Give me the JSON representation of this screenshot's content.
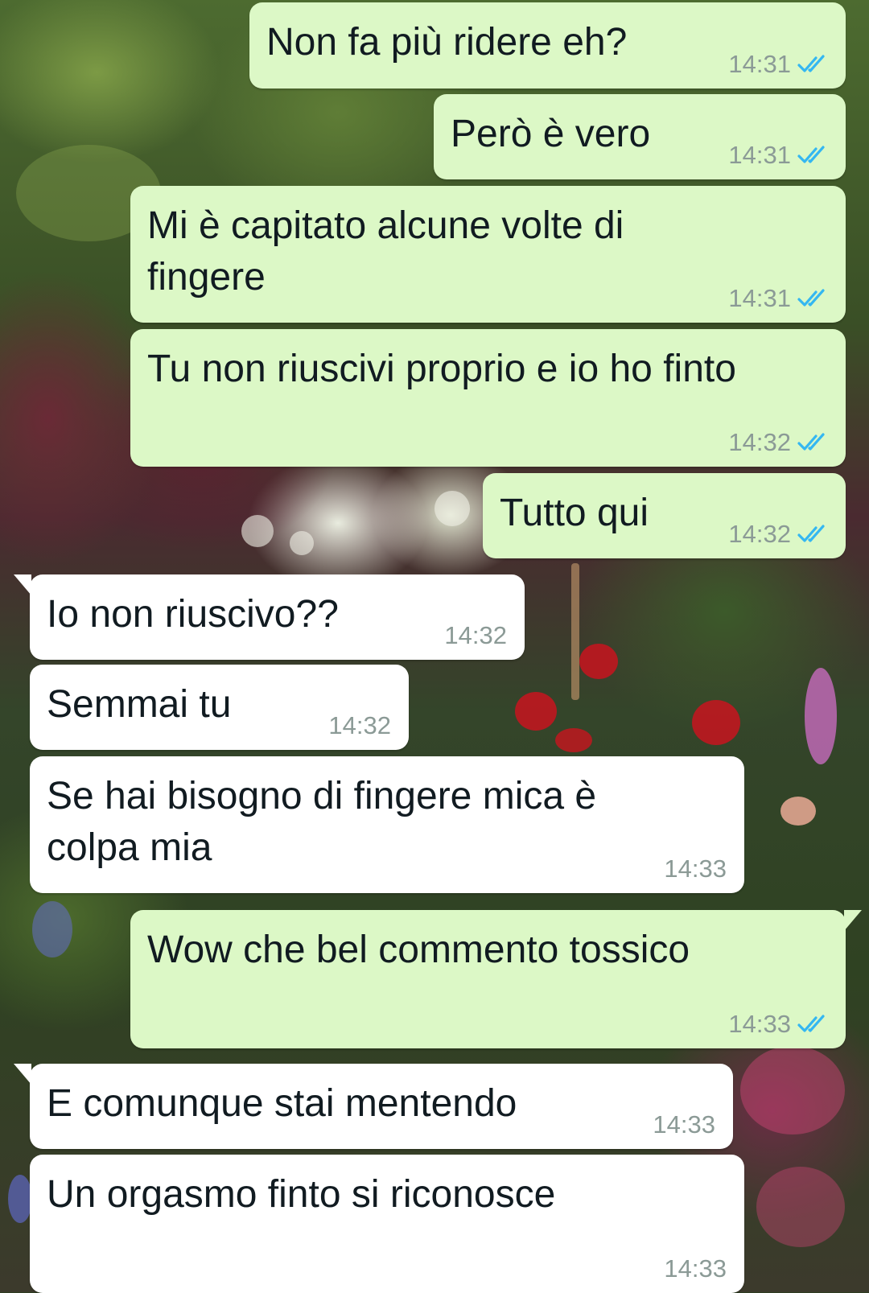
{
  "messages": [
    {
      "direction": "out",
      "text": "Non fa più ridere eh?",
      "time": "14:31",
      "status": "read"
    },
    {
      "direction": "out",
      "text": "Però è vero",
      "time": "14:31",
      "status": "read"
    },
    {
      "direction": "out",
      "text": "Mi è capitato alcune volte di\nfingere",
      "time": "14:31",
      "status": "read"
    },
    {
      "direction": "out",
      "text": "Tu non riuscivi proprio e io ho finto",
      "time": "14:32",
      "status": "read"
    },
    {
      "direction": "out",
      "text": "Tutto qui",
      "time": "14:32",
      "status": "read"
    },
    {
      "direction": "in",
      "text": "Io non riuscivo??",
      "time": "14:32"
    },
    {
      "direction": "in",
      "text": "Semmai tu",
      "time": "14:32"
    },
    {
      "direction": "in",
      "text": "Se hai bisogno di fingere mica è\ncolpa mia",
      "time": "14:33"
    },
    {
      "direction": "out",
      "text": "Wow che bel commento tossico",
      "time": "14:33",
      "status": "read"
    },
    {
      "direction": "in",
      "text": "E comunque stai mentendo",
      "time": "14:33"
    },
    {
      "direction": "in",
      "text": "Un orgasmo finto si riconosce",
      "time": "14:33"
    }
  ],
  "colors": {
    "outgoing_bubble": "#dcf8c6",
    "incoming_bubble": "#ffffff",
    "read_ticks": "#34b7f1",
    "timestamp": "#8b9a96"
  },
  "icons": {
    "read_receipt": "double-check-icon"
  },
  "wallpaper": "garden-photo"
}
